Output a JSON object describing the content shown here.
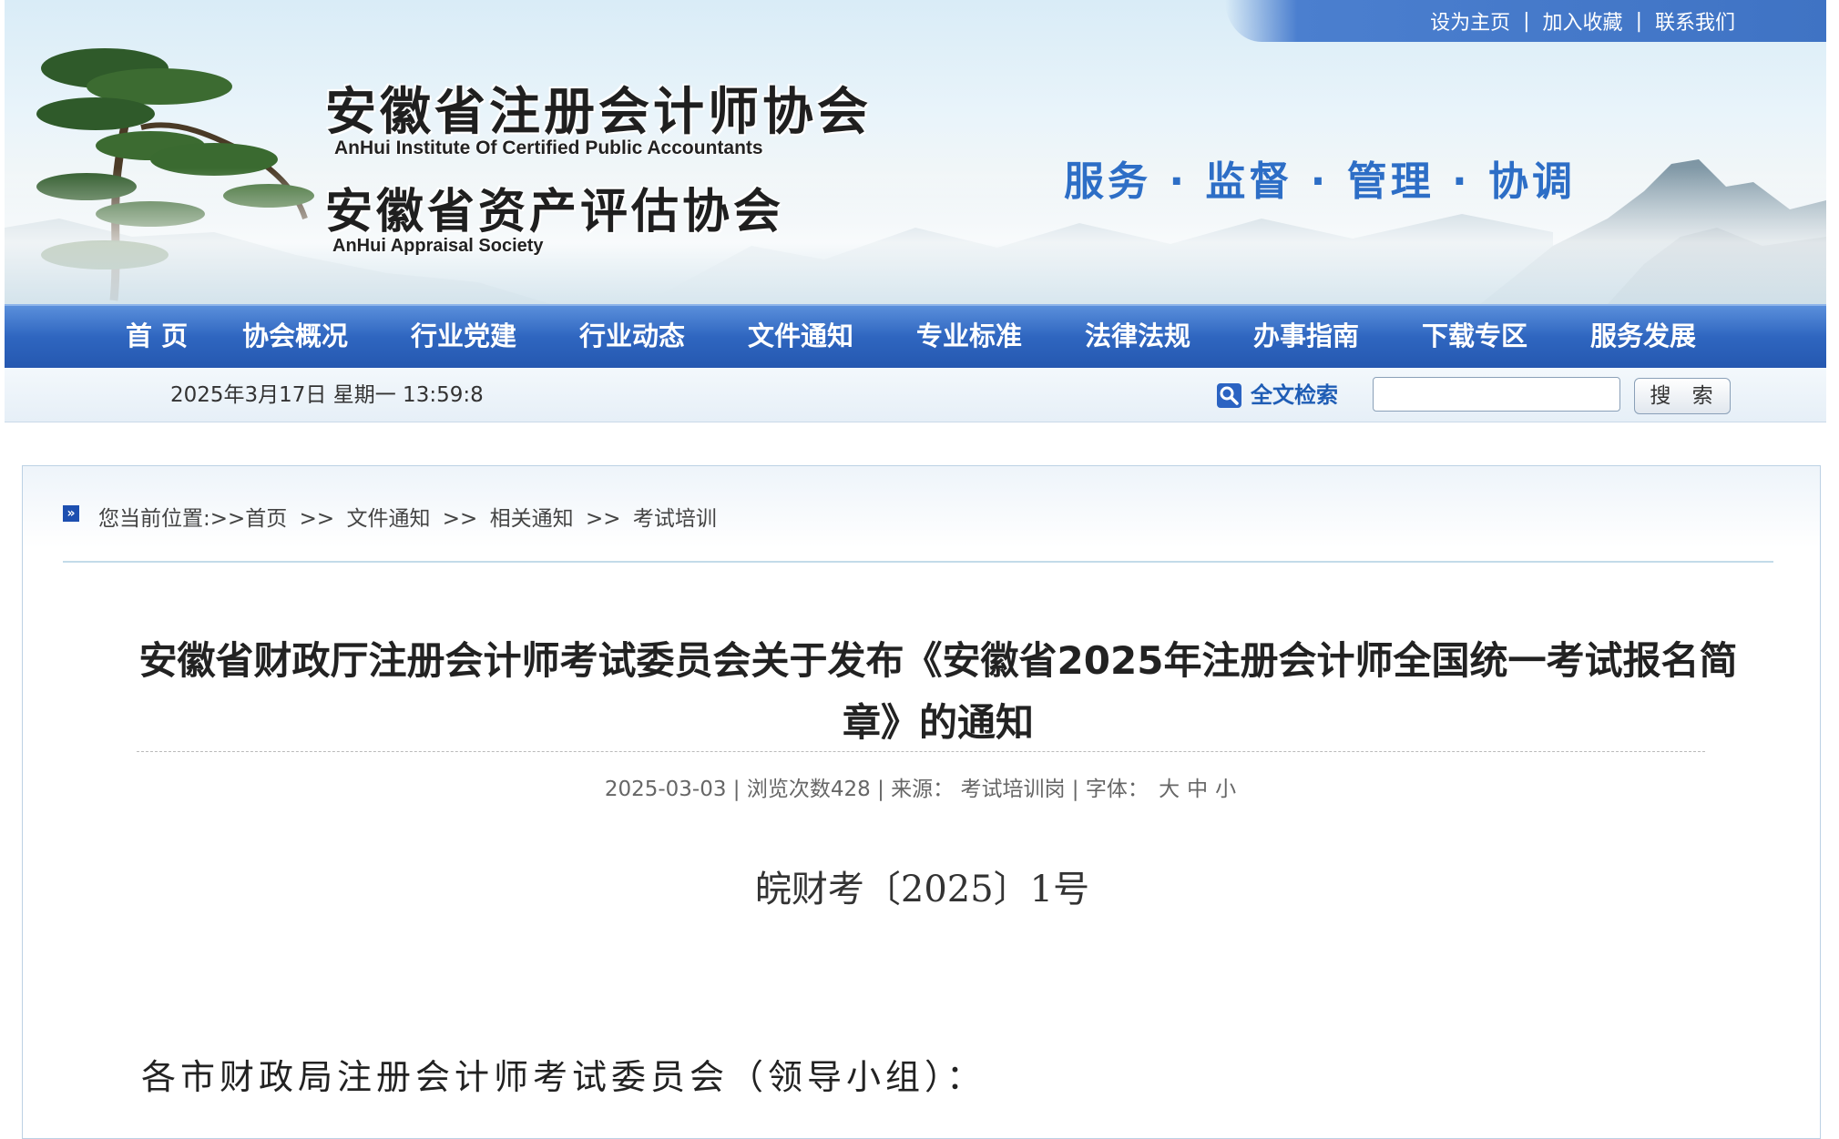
{
  "header": {
    "top_links": [
      "设为主页",
      "加入收藏",
      "联系我们"
    ],
    "logo": {
      "org1_cn": "安徽省注册会计师协会",
      "org1_en": "AnHui Institute Of Certified Public Accountants",
      "org2_cn": "安徽省资产评估协会",
      "org2_en": "AnHui Appraisal Society"
    },
    "slogan": "服务 · 监督 · 管理 · 协调"
  },
  "nav": {
    "items": [
      "首 页",
      "协会概况",
      "行业党建",
      "行业动态",
      "文件通知",
      "专业标准",
      "法律法规",
      "办事指南",
      "下载专区",
      "服务发展"
    ]
  },
  "subbar": {
    "datetime": "2025年3月17日 星期一 13:59:8",
    "search_label": "全文检索",
    "search_value": "",
    "search_button": "搜 索"
  },
  "breadcrumb": {
    "prefix": "您当前位置:>>",
    "items": [
      "首页",
      "文件通知",
      "相关通知",
      "考试培训"
    ],
    "separator": ">>"
  },
  "article": {
    "title": "安徽省财政厅注册会计师考试委员会关于发布《安徽省2025年注册会计师全国统一考试报名简章》的通知",
    "date": "2025-03-03",
    "views": "浏览次数428",
    "source_label": "来源：",
    "source": "考试培训岗",
    "font_label": "字体：",
    "font_sizes": [
      "大",
      "中",
      "小"
    ],
    "doc_number": "皖财考〔2025〕1号",
    "salutation": "各市财政局注册会计师考试委员会（领导小组）："
  },
  "colors": {
    "nav_blue": "#2f66c0",
    "slogan_blue": "#2d6ec6",
    "link_blue": "#1f5db5"
  }
}
